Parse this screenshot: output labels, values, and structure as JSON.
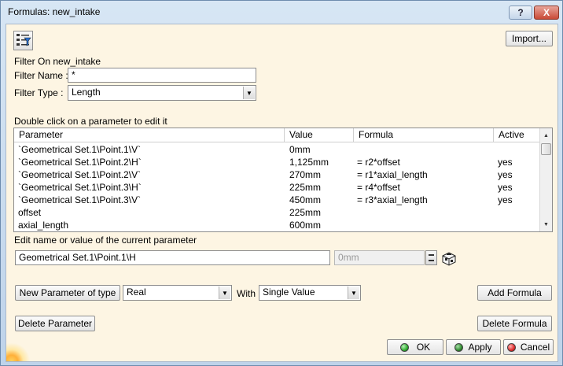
{
  "window": {
    "title": "Formulas: new_intake",
    "help_label": "?",
    "close_label": "X"
  },
  "toolbar": {
    "import_label": "Import..."
  },
  "filter": {
    "on_label": "Filter On new_intake",
    "name_label": "Filter Name :",
    "name_value": "*",
    "type_label": "Filter Type :",
    "type_value": "Length"
  },
  "table": {
    "caption": "Double click on a parameter to edit it",
    "columns": [
      "Parameter",
      "Value",
      "Formula",
      "Active"
    ],
    "rows": [
      {
        "parameter": "`Geometrical Set.1\\Point.1\\V`",
        "value": "0mm",
        "formula": "",
        "active": ""
      },
      {
        "parameter": "`Geometrical Set.1\\Point.2\\H`",
        "value": "1,125mm",
        "formula": "= r2*offset",
        "active": "yes"
      },
      {
        "parameter": "`Geometrical Set.1\\Point.2\\V`",
        "value": "270mm",
        "formula": "= r1*axial_length",
        "active": "yes"
      },
      {
        "parameter": "`Geometrical Set.1\\Point.3\\H`",
        "value": "225mm",
        "formula": "= r4*offset",
        "active": "yes"
      },
      {
        "parameter": "`Geometrical Set.1\\Point.3\\V`",
        "value": "450mm",
        "formula": "= r3*axial_length",
        "active": "yes"
      },
      {
        "parameter": "offset",
        "value": "225mm",
        "formula": "",
        "active": ""
      },
      {
        "parameter": "axial_length",
        "value": "600mm",
        "formula": "",
        "active": ""
      }
    ]
  },
  "edit": {
    "label": "Edit name or value of the current parameter",
    "name_value": "Geometrical Set.1\\Point.1\\H",
    "value_value": "0mm"
  },
  "new_param": {
    "button_label": "New Parameter of type",
    "type_value": "Real",
    "with_label": "With",
    "with_value": "Single Value",
    "add_formula_label": "Add Formula"
  },
  "actions": {
    "delete_parameter_label": "Delete Parameter",
    "delete_formula_label": "Delete Formula",
    "ok_label": "OK",
    "apply_label": "Apply",
    "cancel_label": "Cancel"
  },
  "colors": {
    "client_bg": "#fdf5e3",
    "ok_dot": "#2fae2f",
    "apply_dot": "#2f8a2f",
    "cancel_dot": "#e02a2a"
  }
}
